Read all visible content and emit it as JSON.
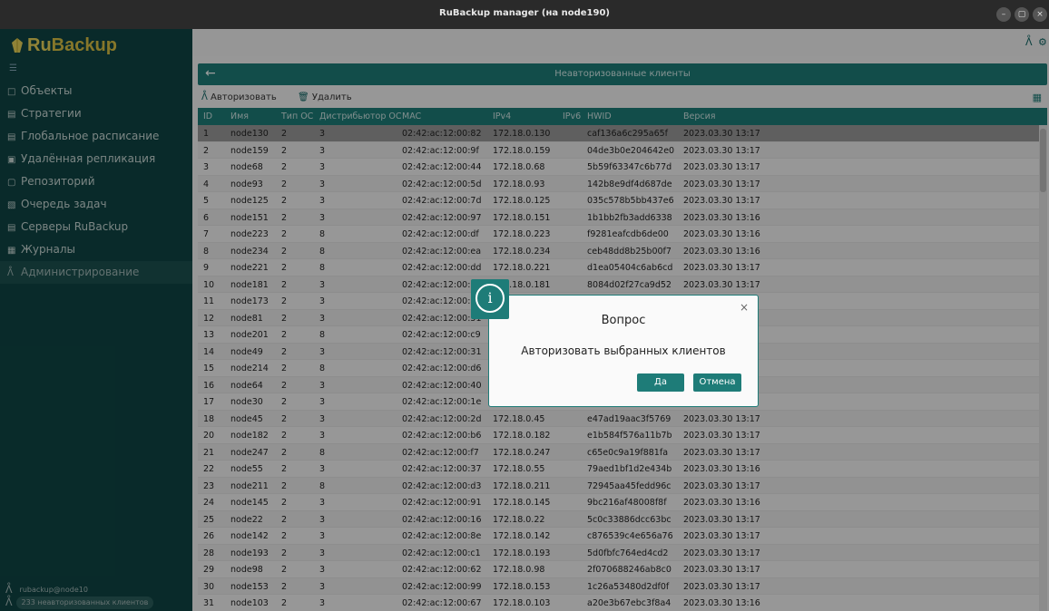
{
  "window": {
    "title": "RuBackup manager (на node190)"
  },
  "sidebar": {
    "logo_ru": "Ru",
    "logo_backup": "Backup",
    "items": [
      {
        "icon": "□",
        "label": "Объекты"
      },
      {
        "icon": "▤",
        "label": "Стратегии"
      },
      {
        "icon": "▤",
        "label": "Глобальное расписание"
      },
      {
        "icon": "▣",
        "label": "Удалённая репликация"
      },
      {
        "icon": "▢",
        "label": "Репозиторий"
      },
      {
        "icon": "▧",
        "label": "Очередь задач"
      },
      {
        "icon": "▤",
        "label": "Серверы RuBackup"
      },
      {
        "icon": "▦",
        "label": "Журналы"
      },
      {
        "icon": "ᐰ",
        "label": "Администрирование"
      }
    ],
    "user": "rubackup@node10",
    "unauth_badge": "233 неавторизованных клиентов"
  },
  "panel": {
    "title": "Неавторизованные клиенты",
    "authorize_label": "Авторизовать",
    "delete_label": "Удалить"
  },
  "table": {
    "headers": {
      "id": "ID",
      "name": "Имя",
      "os": "Тип ОС",
      "dist": "Дистрибьютор ОС",
      "mac": "MAC",
      "ipv4": "IPv4",
      "ipv6": "IPv6",
      "hwid": "HWID",
      "version": "Версия"
    },
    "rows": [
      {
        "id": "1",
        "name": "node130",
        "os": "2",
        "dist": "3",
        "mac": "02:42:ac:12:00:82",
        "ip": "172.18.0.130",
        "hwid": "caf136a6c295a65f",
        "ver": "2023.03.30 13:17"
      },
      {
        "id": "2",
        "name": "node159",
        "os": "2",
        "dist": "3",
        "mac": "02:42:ac:12:00:9f",
        "ip": "172.18.0.159",
        "hwid": "04de3b0e204642e0",
        "ver": "2023.03.30 13:17"
      },
      {
        "id": "3",
        "name": "node68",
        "os": "2",
        "dist": "3",
        "mac": "02:42:ac:12:00:44",
        "ip": "172.18.0.68",
        "hwid": "5b59f63347c6b77d",
        "ver": "2023.03.30 13:17"
      },
      {
        "id": "4",
        "name": "node93",
        "os": "2",
        "dist": "3",
        "mac": "02:42:ac:12:00:5d",
        "ip": "172.18.0.93",
        "hwid": "142b8e9df4d687de",
        "ver": "2023.03.30 13:17"
      },
      {
        "id": "5",
        "name": "node125",
        "os": "2",
        "dist": "3",
        "mac": "02:42:ac:12:00:7d",
        "ip": "172.18.0.125",
        "hwid": "035c578b5bb437e6",
        "ver": "2023.03.30 13:17"
      },
      {
        "id": "6",
        "name": "node151",
        "os": "2",
        "dist": "3",
        "mac": "02:42:ac:12:00:97",
        "ip": "172.18.0.151",
        "hwid": "1b1bb2fb3add6338",
        "ver": "2023.03.30 13:16"
      },
      {
        "id": "7",
        "name": "node223",
        "os": "2",
        "dist": "8",
        "mac": "02:42:ac:12:00:df",
        "ip": "172.18.0.223",
        "hwid": "f9281eafcdb6de00",
        "ver": "2023.03.30 13:16"
      },
      {
        "id": "8",
        "name": "node234",
        "os": "2",
        "dist": "8",
        "mac": "02:42:ac:12:00:ea",
        "ip": "172.18.0.234",
        "hwid": "ceb48dd8b25b00f7",
        "ver": "2023.03.30 13:16"
      },
      {
        "id": "9",
        "name": "node221",
        "os": "2",
        "dist": "8",
        "mac": "02:42:ac:12:00:dd",
        "ip": "172.18.0.221",
        "hwid": "d1ea05404c6ab6cd",
        "ver": "2023.03.30 13:17"
      },
      {
        "id": "10",
        "name": "node181",
        "os": "2",
        "dist": "3",
        "mac": "02:42:ac:12:00:b5",
        "ip": "172.18.0.181",
        "hwid": "8084d02f27ca9d52",
        "ver": "2023.03.30 13:17"
      },
      {
        "id": "11",
        "name": "node173",
        "os": "2",
        "dist": "3",
        "mac": "02:42:ac:12:00:ad",
        "ip": "",
        "hwid": "",
        "ver": ""
      },
      {
        "id": "12",
        "name": "node81",
        "os": "2",
        "dist": "3",
        "mac": "02:42:ac:12:00:51",
        "ip": "",
        "hwid": "",
        "ver": ""
      },
      {
        "id": "13",
        "name": "node201",
        "os": "2",
        "dist": "8",
        "mac": "02:42:ac:12:00:c9",
        "ip": "",
        "hwid": "",
        "ver": ""
      },
      {
        "id": "14",
        "name": "node49",
        "os": "2",
        "dist": "3",
        "mac": "02:42:ac:12:00:31",
        "ip": "",
        "hwid": "",
        "ver": ""
      },
      {
        "id": "15",
        "name": "node214",
        "os": "2",
        "dist": "8",
        "mac": "02:42:ac:12:00:d6",
        "ip": "",
        "hwid": "",
        "ver": ""
      },
      {
        "id": "16",
        "name": "node64",
        "os": "2",
        "dist": "3",
        "mac": "02:42:ac:12:00:40",
        "ip": "",
        "hwid": "",
        "ver": ""
      },
      {
        "id": "17",
        "name": "node30",
        "os": "2",
        "dist": "3",
        "mac": "02:42:ac:12:00:1e",
        "ip": "",
        "hwid": "",
        "ver": ""
      },
      {
        "id": "18",
        "name": "node45",
        "os": "2",
        "dist": "3",
        "mac": "02:42:ac:12:00:2d",
        "ip": "172.18.0.45",
        "hwid": "e47ad19aac3f5769",
        "ver": "2023.03.30 13:17"
      },
      {
        "id": "20",
        "name": "node182",
        "os": "2",
        "dist": "3",
        "mac": "02:42:ac:12:00:b6",
        "ip": "172.18.0.182",
        "hwid": "e1b584f576a11b7b",
        "ver": "2023.03.30 13:17"
      },
      {
        "id": "21",
        "name": "node247",
        "os": "2",
        "dist": "8",
        "mac": "02:42:ac:12:00:f7",
        "ip": "172.18.0.247",
        "hwid": "c65e0c9a19f881fa",
        "ver": "2023.03.30 13:17"
      },
      {
        "id": "22",
        "name": "node55",
        "os": "2",
        "dist": "3",
        "mac": "02:42:ac:12:00:37",
        "ip": "172.18.0.55",
        "hwid": "79aed1bf1d2e434b",
        "ver": "2023.03.30 13:16"
      },
      {
        "id": "23",
        "name": "node211",
        "os": "2",
        "dist": "8",
        "mac": "02:42:ac:12:00:d3",
        "ip": "172.18.0.211",
        "hwid": "72945aa45fedd96c",
        "ver": "2023.03.30 13:17"
      },
      {
        "id": "24",
        "name": "node145",
        "os": "2",
        "dist": "3",
        "mac": "02:42:ac:12:00:91",
        "ip": "172.18.0.145",
        "hwid": "9bc216af48008f8f",
        "ver": "2023.03.30 13:16"
      },
      {
        "id": "25",
        "name": "node22",
        "os": "2",
        "dist": "3",
        "mac": "02:42:ac:12:00:16",
        "ip": "172.18.0.22",
        "hwid": "5c0c33886dcc63bc",
        "ver": "2023.03.30 13:17"
      },
      {
        "id": "26",
        "name": "node142",
        "os": "2",
        "dist": "3",
        "mac": "02:42:ac:12:00:8e",
        "ip": "172.18.0.142",
        "hwid": "c876539c4e656a76",
        "ver": "2023.03.30 13:17"
      },
      {
        "id": "28",
        "name": "node193",
        "os": "2",
        "dist": "3",
        "mac": "02:42:ac:12:00:c1",
        "ip": "172.18.0.193",
        "hwid": "5d0fbfc764ed4cd2",
        "ver": "2023.03.30 13:17"
      },
      {
        "id": "29",
        "name": "node98",
        "os": "2",
        "dist": "3",
        "mac": "02:42:ac:12:00:62",
        "ip": "172.18.0.98",
        "hwid": "2f070688246ab8c0",
        "ver": "2023.03.30 13:17"
      },
      {
        "id": "30",
        "name": "node153",
        "os": "2",
        "dist": "3",
        "mac": "02:42:ac:12:00:99",
        "ip": "172.18.0.153",
        "hwid": "1c26a53480d2df0f",
        "ver": "2023.03.30 13:17"
      },
      {
        "id": "31",
        "name": "node103",
        "os": "2",
        "dist": "3",
        "mac": "02:42:ac:12:00:67",
        "ip": "172.18.0.103",
        "hwid": "a20e3b67ebc3f8a4",
        "ver": "2023.03.30 13:16"
      }
    ]
  },
  "dialog": {
    "icon": "i",
    "title": "Вопрос",
    "message": "Авторизовать выбранных клиентов",
    "yes_label": "Да",
    "no_label": "Отмена",
    "close": "×"
  },
  "colors": {
    "accent": "#1e7c78",
    "sidebar": "#0f4544",
    "logo": "#e8d45a"
  }
}
